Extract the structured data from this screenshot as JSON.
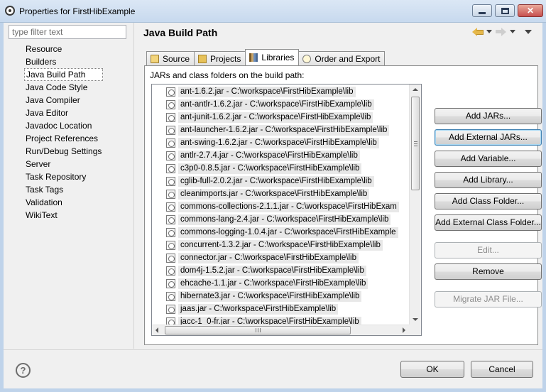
{
  "window": {
    "title": "Properties for FirstHibExample"
  },
  "filter": {
    "placeholder": "type filter text",
    "value": ""
  },
  "nav": [
    {
      "label": "Resource"
    },
    {
      "label": "Builders"
    },
    {
      "label": "Java Build Path",
      "selected": true
    },
    {
      "label": "Java Code Style"
    },
    {
      "label": "Java Compiler"
    },
    {
      "label": "Java Editor"
    },
    {
      "label": "Javadoc Location"
    },
    {
      "label": "Project References"
    },
    {
      "label": "Run/Debug Settings"
    },
    {
      "label": "Server"
    },
    {
      "label": "Task Repository"
    },
    {
      "label": "Task Tags"
    },
    {
      "label": "Validation"
    },
    {
      "label": "WikiText"
    }
  ],
  "page": {
    "title": "Java Build Path"
  },
  "tabs": [
    {
      "label": "Source",
      "icon": "source-folder-icon"
    },
    {
      "label": "Projects",
      "icon": "projects-icon"
    },
    {
      "label": "Libraries",
      "icon": "libraries-icon",
      "active": true
    },
    {
      "label": "Order and Export",
      "icon": "order-export-icon"
    }
  ],
  "libraries": {
    "label": "JARs and class folders on the build path:",
    "jars": [
      "ant-1.6.2.jar - C:\\workspace\\FirstHibExample\\lib",
      "ant-antlr-1.6.2.jar - C:\\workspace\\FirstHibExample\\lib",
      "ant-junit-1.6.2.jar - C:\\workspace\\FirstHibExample\\lib",
      "ant-launcher-1.6.2.jar - C:\\workspace\\FirstHibExample\\lib",
      "ant-swing-1.6.2.jar - C:\\workspace\\FirstHibExample\\lib",
      "antlr-2.7.4.jar - C:\\workspace\\FirstHibExample\\lib",
      "c3p0-0.8.5.jar - C:\\workspace\\FirstHibExample\\lib",
      "cglib-full-2.0.2.jar - C:\\workspace\\FirstHibExample\\lib",
      "cleanimports.jar - C:\\workspace\\FirstHibExample\\lib",
      "commons-collections-2.1.1.jar - C:\\workspace\\FirstHibExam",
      "commons-lang-2.4.jar - C:\\workspace\\FirstHibExample\\lib",
      "commons-logging-1.0.4.jar - C:\\workspace\\FirstHibExample",
      "concurrent-1.3.2.jar - C:\\workspace\\FirstHibExample\\lib",
      "connector.jar - C:\\workspace\\FirstHibExample\\lib",
      "dom4j-1.5.2.jar - C:\\workspace\\FirstHibExample\\lib",
      "ehcache-1.1.jar - C:\\workspace\\FirstHibExample\\lib",
      "hibernate3.jar - C:\\workspace\\FirstHibExample\\lib",
      "jaas.jar - C:\\workspace\\FirstHibExample\\lib",
      "jacc-1_0-fr.jar - C:\\workspace\\FirstHibExample\\lib"
    ]
  },
  "buttons": {
    "add_jars": {
      "label": "Add JARs...",
      "enabled": true
    },
    "add_external_jars": {
      "label": "Add External JARs...",
      "enabled": true
    },
    "add_variable": {
      "label": "Add Variable...",
      "enabled": true
    },
    "add_library": {
      "label": "Add Library...",
      "enabled": true
    },
    "add_class_folder": {
      "label": "Add Class Folder...",
      "enabled": true
    },
    "add_external_class_folder": {
      "label": "Add External Class Folder...",
      "enabled": true
    },
    "edit": {
      "label": "Edit...",
      "enabled": false
    },
    "remove": {
      "label": "Remove",
      "enabled": true
    },
    "migrate_jar": {
      "label": "Migrate JAR File...",
      "enabled": false
    }
  },
  "footer": {
    "ok_label": "OK",
    "cancel_label": "Cancel",
    "help_icon": "help-icon"
  }
}
